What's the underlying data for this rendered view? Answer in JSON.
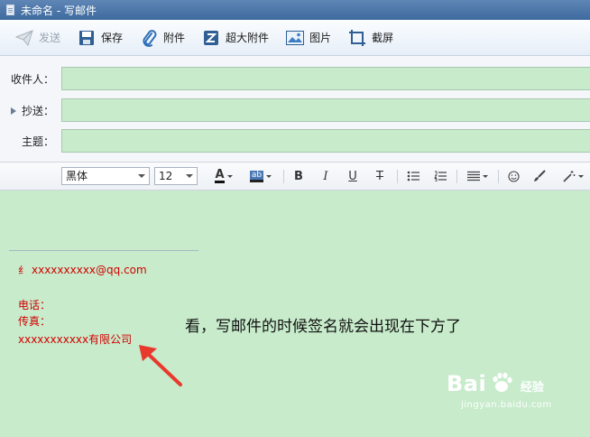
{
  "window": {
    "title": "未命名 - 写邮件"
  },
  "toolbar": {
    "send_label": "发送",
    "save_label": "保存",
    "attach_label": "附件",
    "large_attach_label": "超大附件",
    "image_label": "图片",
    "screenshot_label": "截屏"
  },
  "fields": {
    "to_label": "收件人：",
    "cc_label": "抄送：",
    "subject_label": "主题："
  },
  "format": {
    "font_family": "黑体",
    "font_size": "12",
    "bold": "B",
    "italic": "I",
    "underline": "U",
    "strike": "T",
    "highlight_glyph": "ab",
    "color_glyph": "A"
  },
  "signature": {
    "email": "xxxxxxxxxx@qq.com",
    "phone": "电话：",
    "fax": "传真：",
    "company": "xxxxxxxxxxx有限公司"
  },
  "annotation": "看，写邮件的时候签名就会出现在下方了",
  "watermark": {
    "brand": "Bai",
    "brand2": "经验",
    "url": "jingyan.baidu.com"
  },
  "colors": {
    "editor_bg": "#c7ebcb",
    "signature": "#d40000",
    "arrow": "#e83a2c"
  }
}
